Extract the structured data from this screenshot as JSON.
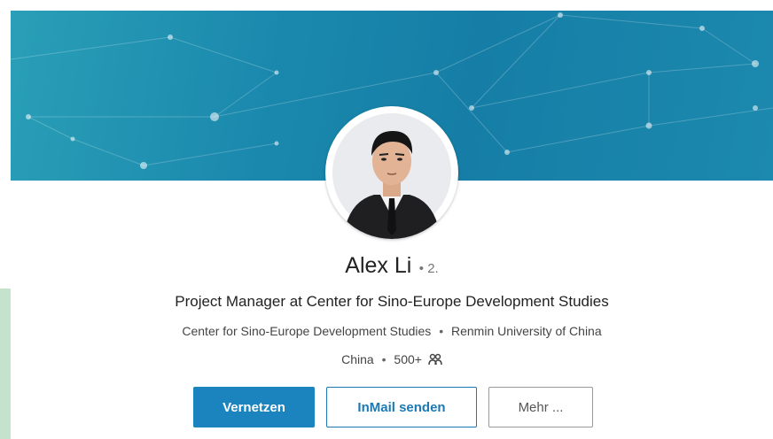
{
  "profile": {
    "name": "Alex Li",
    "degree": "• 2.",
    "headline": "Project Manager at Center for Sino-Europe Development Studies",
    "company": "Center for Sino-Europe Development Studies",
    "education": "Renmin University of China",
    "location": "China",
    "connections": "500+",
    "separator": "•",
    "connections_icon": "people-icon"
  },
  "actions": {
    "connect_label": "Vernetzen",
    "inmail_label": "InMail senden",
    "more_label": "Mehr ..."
  },
  "colors": {
    "banner": "#1a88ad",
    "primary_button": "#1b83bd",
    "accent_text": "#1b79b4"
  }
}
